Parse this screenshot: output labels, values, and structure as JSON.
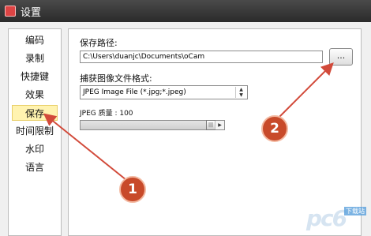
{
  "window": {
    "title": "设置"
  },
  "sidebar": {
    "items": [
      {
        "label": "编码"
      },
      {
        "label": "录制"
      },
      {
        "label": "快捷键"
      },
      {
        "label": "效果"
      },
      {
        "label": "保存"
      },
      {
        "label": "时间限制"
      },
      {
        "label": "水印"
      },
      {
        "label": "语言"
      }
    ],
    "selected": "保存"
  },
  "save": {
    "path_label": "保存路径:",
    "path_value": "C:\\Users\\duanjc\\Documents\\oCam",
    "browse_label": "...",
    "format_label": "捕获图像文件格式:",
    "format_value": "JPEG Image File (*.jpg;*.jpeg)",
    "quality_label": "JPEG 质量 : 100",
    "quality_fraction": 1.0
  },
  "annotations": [
    {
      "label": "1"
    },
    {
      "label": "2"
    }
  ],
  "watermark": {
    "text": "pc6",
    "sub": "下载站"
  },
  "colors": {
    "callout": "#c84a2a",
    "arrow": "#d24a3a",
    "selected_item_bg": "#fff3b0"
  }
}
